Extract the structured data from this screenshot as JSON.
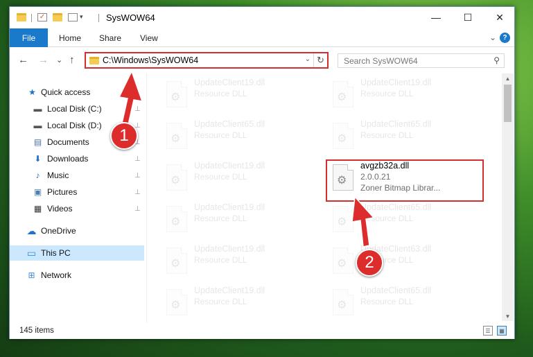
{
  "window": {
    "title": "SysWOW64"
  },
  "title_buttons": {
    "minimize": "—",
    "maximize": "☐",
    "close": "✕"
  },
  "ribbon": {
    "tabs": [
      "File",
      "Home",
      "Share",
      "View"
    ],
    "chevron": "⌄",
    "help": "?"
  },
  "nav": {
    "back": "←",
    "forward": "→",
    "recent": "⌄",
    "up": "↑",
    "address": "C:\\Windows\\SysWOW64",
    "address_dropdown": "⌄",
    "refresh": "↻",
    "search_placeholder": "Search SysWOW64",
    "search_icon": "⚲"
  },
  "sidebar": {
    "items": [
      {
        "label": "Quick access",
        "icon": "star-icon",
        "glyph": "★",
        "pinned": false
      },
      {
        "label": "Local Disk (C:)",
        "icon": "drive-icon",
        "glyph": "▬",
        "pinned": true
      },
      {
        "label": "Local Disk (D:)",
        "icon": "drive-icon",
        "glyph": "▬",
        "pinned": true
      },
      {
        "label": "Documents",
        "icon": "documents-icon",
        "glyph": "▤",
        "pinned": true
      },
      {
        "label": "Downloads",
        "icon": "download-icon",
        "glyph": "⬇",
        "pinned": true
      },
      {
        "label": "Music",
        "icon": "music-icon",
        "glyph": "♪",
        "pinned": true
      },
      {
        "label": "Pictures",
        "icon": "pictures-icon",
        "glyph": "▣",
        "pinned": true
      },
      {
        "label": "Videos",
        "icon": "videos-icon",
        "glyph": "▦",
        "pinned": true
      },
      {
        "label": "OneDrive",
        "icon": "cloud-icon",
        "glyph": "☁",
        "pinned": false
      },
      {
        "label": "This PC",
        "icon": "computer-icon",
        "glyph": "▭",
        "pinned": false
      },
      {
        "label": "Network",
        "icon": "network-icon",
        "glyph": "⊞",
        "pinned": false
      }
    ],
    "pin_glyph": "⊥"
  },
  "files": [
    {
      "name": "UpdateClient19.dll",
      "line2": "Resource DLL",
      "line3": "",
      "faded": true
    },
    {
      "name": "UpdateClient19.dll",
      "line2": "Resource DLL",
      "line3": "",
      "faded": true
    },
    {
      "name": "UpdateClient65.dll",
      "line2": "Resource DLL",
      "line3": "",
      "faded": true
    },
    {
      "name": "UpdateClient65.dll",
      "line2": "Resource DLL",
      "line3": "",
      "faded": true
    },
    {
      "name": "UpdateClient19.dll",
      "line2": "Resource DLL",
      "line3": "",
      "faded": true
    },
    {
      "name": "avgzb32a.dll",
      "line2": "2.0.0.21",
      "line3": "Zoner Bitmap Librar...",
      "faded": false
    },
    {
      "name": "UpdateClient19.dll",
      "line2": "Resource DLL",
      "line3": "",
      "faded": true
    },
    {
      "name": "UpdateClient65.dll",
      "line2": "Resource DLL",
      "line3": "",
      "faded": true
    },
    {
      "name": "UpdateClient19.dll",
      "line2": "Resource DLL",
      "line3": "",
      "faded": true
    },
    {
      "name": "UpdateClient63.dll",
      "line2": "Resource DLL",
      "line3": "",
      "faded": true
    },
    {
      "name": "UpdateClient19.dll",
      "line2": "Resource DLL",
      "line3": "",
      "faded": true
    },
    {
      "name": "UpdateClient65.dll",
      "line2": "Resource DLL",
      "line3": "",
      "faded": true
    }
  ],
  "file_icon_glyph": "⚙",
  "status": {
    "item_count": "145 items"
  },
  "scroll": {
    "up": "▲",
    "down": "▼"
  },
  "view_buttons": {
    "details": "☰",
    "large_icons": "▦"
  },
  "annotations": {
    "step1": "1",
    "step2": "2",
    "color": "#dd2c2c"
  }
}
